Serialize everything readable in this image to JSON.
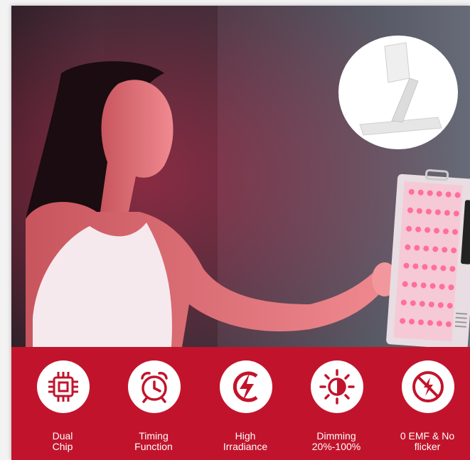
{
  "features": [
    {
      "icon": "chip-icon",
      "line1": "Dual",
      "line2": "Chip"
    },
    {
      "icon": "alarm-clock-icon",
      "line1": "Timing",
      "line2": "Function"
    },
    {
      "icon": "lightning-icon",
      "line1": "High",
      "line2": "Irradiance"
    },
    {
      "icon": "brightness-icon",
      "line1": "Dimming",
      "line2": "20%-100%"
    },
    {
      "icon": "no-flicker-icon",
      "line1": "0 EMF & No",
      "line2": "flicker"
    }
  ],
  "colors": {
    "band": "#c1142c",
    "icon": "#c1142c",
    "panel": "#f2e8ec",
    "led": "#ff6f9a"
  }
}
